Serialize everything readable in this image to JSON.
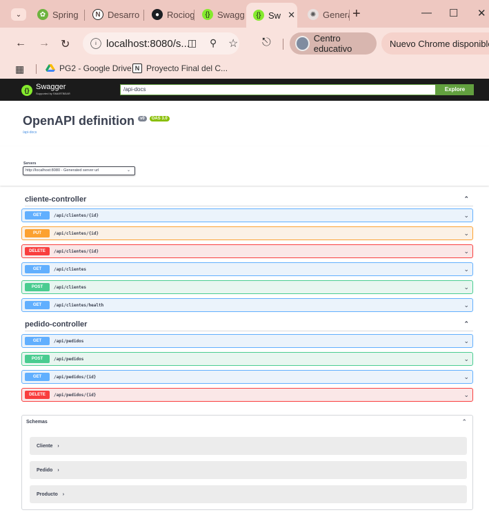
{
  "browser": {
    "tabs": [
      {
        "label": "Spring",
        "icon": "spring-icon"
      },
      {
        "label": "Desarro",
        "icon": "notion-icon"
      },
      {
        "label": "Rociog",
        "icon": "github-icon"
      },
      {
        "label": "Swagge",
        "icon": "swagger-icon"
      },
      {
        "label": "Sw",
        "icon": "swagger-icon",
        "active": true
      },
      {
        "label": "Genera",
        "icon": "openai-icon"
      }
    ],
    "url": "localhost:8080/s...",
    "profile_label": "Centro educativo",
    "update_label": "Nuevo Chrome disponible",
    "bookmarks": [
      {
        "label": "PG2 - Google Drive",
        "icon": "google-drive-icon"
      },
      {
        "label": "Proyecto Final del C...",
        "icon": "notion-icon"
      }
    ]
  },
  "swagger": {
    "logo_text": "Swagger",
    "logo_sub": "Supported by SMARTBEAR",
    "url_value": "/api-docs",
    "explore_label": "Explore",
    "title": "OpenAPI definition",
    "version_badge": "v0",
    "oas_badge": "OAS 3.0",
    "spec_link": "/api-docs",
    "servers_label": "Servers",
    "server_selected": "http://localhost:8080 - Generated server url",
    "tags": [
      {
        "name": "cliente-controller",
        "operations": [
          {
            "method": "GET",
            "path": "/api/clientes/{id}"
          },
          {
            "method": "PUT",
            "path": "/api/clientes/{id}"
          },
          {
            "method": "DELETE",
            "path": "/api/clientes/{id}"
          },
          {
            "method": "GET",
            "path": "/api/clientes"
          },
          {
            "method": "POST",
            "path": "/api/clientes"
          },
          {
            "method": "GET",
            "path": "/api/clientes/health"
          }
        ]
      },
      {
        "name": "pedido-controller",
        "operations": [
          {
            "method": "GET",
            "path": "/api/pedidos"
          },
          {
            "method": "POST",
            "path": "/api/pedidos"
          },
          {
            "method": "GET",
            "path": "/api/pedidos/{id}"
          },
          {
            "method": "DELETE",
            "path": "/api/pedidos/{id}"
          }
        ]
      }
    ],
    "schemas_label": "Schemas",
    "schemas": [
      "Cliente",
      "Pedido",
      "Producto"
    ]
  },
  "colors": {
    "get": "#61affe",
    "put": "#fca130",
    "delete": "#f93e3e",
    "post": "#49cc90",
    "swagger_topbar": "#1b1b1b",
    "explore": "#62a03f",
    "chrome_frame": "#eec8c1"
  }
}
